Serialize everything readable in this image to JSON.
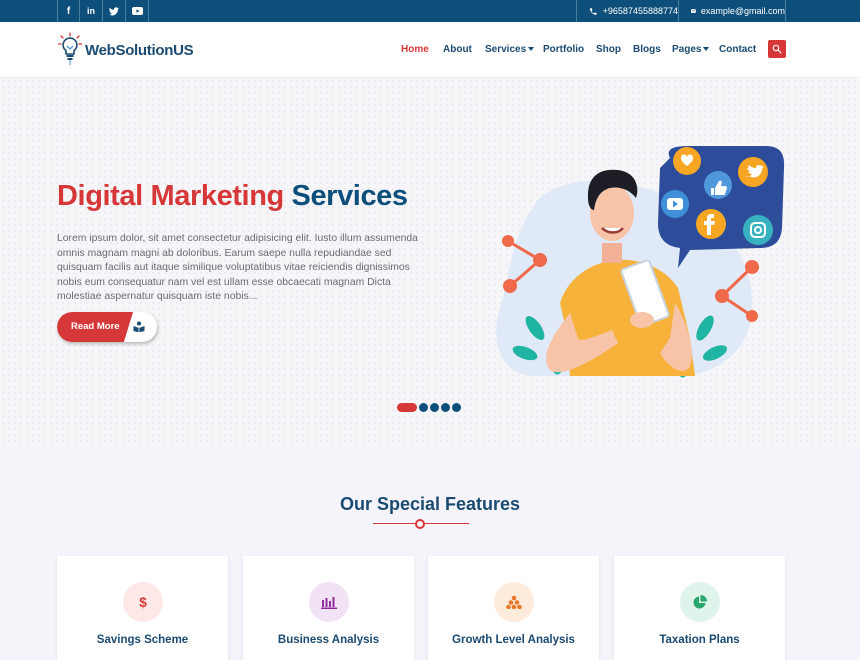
{
  "topbar": {
    "social": [
      {
        "name": "facebook",
        "glyph": "f"
      },
      {
        "name": "linkedin",
        "glyph": "in"
      },
      {
        "name": "twitter",
        "glyph": "t"
      },
      {
        "name": "youtube",
        "glyph": "▶"
      }
    ],
    "phone": "+96587455888774",
    "email": "example@gmail.com",
    "phone_icon": "phone-icon",
    "email_icon": "envelope-icon"
  },
  "header": {
    "logo_text": "WebSolutionUS",
    "logo_icon": "lightbulb-icon",
    "nav": {
      "home": "Home",
      "about": "About",
      "services": "Services",
      "portfolio": "Portfolio",
      "shop": "Shop",
      "blogs": "Blogs",
      "pages": "Pages",
      "contact": "Contact"
    },
    "active_item": "Home",
    "search_icon": "search-icon"
  },
  "hero": {
    "title_part1": "Digital Marketing",
    "title_part2": "Services",
    "text": "Lorem ipsum dolor, sit amet consectetur adipisicing elit. Iusto illum assumenda omnis magnam magni ab doloribus. Earum saepe nulla repudiandae sed quisquam facilis aut itaque similique voluptatibus vitae reiciendis dignissimos nobis eum consequatur nam vel est ullam esse obcaecati magnam Dicta molestiae aspernatur quisquam iste nobis...",
    "button_label": "Read More",
    "slider": {
      "total": 5,
      "active": 1
    }
  },
  "features": {
    "title": "Our Special Features",
    "cards": [
      {
        "label": "Savings Scheme",
        "icon": "dollar-icon",
        "bg": "#fde7e7",
        "color": "#d6383a"
      },
      {
        "label": "Business Analysis",
        "icon": "bar-chart-icon",
        "bg": "#f1e2f6",
        "color": "#8e2d9a"
      },
      {
        "label": "Growth Level Analysis",
        "icon": "pyramid-icon",
        "bg": "#fdebdc",
        "color": "#e9782a"
      },
      {
        "label": "Taxation Plans",
        "icon": "pie-chart-icon",
        "bg": "#dff4ea",
        "color": "#28a66e"
      }
    ]
  },
  "colors": {
    "primary": "#0d4f7a",
    "accent": "#d6383a",
    "heading": "#1b4b72"
  }
}
